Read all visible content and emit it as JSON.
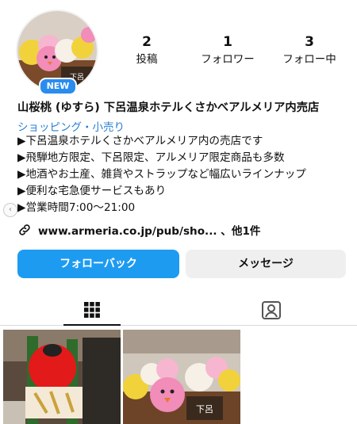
{
  "profile": {
    "new_badge": "NEW",
    "name": "山桜桃 (ゆすら) 下呂温泉ホテルくさかべアルメリア内売店",
    "category": "ショッピング・小売り",
    "bio_lines": [
      "▶下呂温泉ホテルくさかべアルメリア内の売店です",
      "▶飛騨地方限定、下呂限定、アルメリア限定商品も多数",
      "▶地酒やお土産、雑貨やストラップなど幅広いラインナップ",
      "▶便利な宅急便サービスもあり",
      "▶営業時間7:00～21:00"
    ],
    "link_text": "www.armeria.co.jp/pub/sho... 、他1件"
  },
  "stats": {
    "posts": {
      "value": "2",
      "label": "投稿"
    },
    "followers": {
      "value": "1",
      "label": "フォロワー"
    },
    "following": {
      "value": "3",
      "label": "フォロー中"
    }
  },
  "actions": {
    "follow_back": "フォローバック",
    "message": "メッセージ"
  },
  "tabs": [
    {
      "icon": "grid-icon",
      "selected": true
    },
    {
      "icon": "tagged-person-icon",
      "selected": false
    }
  ],
  "posts": [
    {
      "description_icon": "sake-bottles-photo"
    },
    {
      "description_icon": "chick-plush-photo"
    }
  ],
  "colors": {
    "primary_button": "#1d9bf0",
    "category_text": "#2a7fd4",
    "badge": "#2a8cef"
  }
}
